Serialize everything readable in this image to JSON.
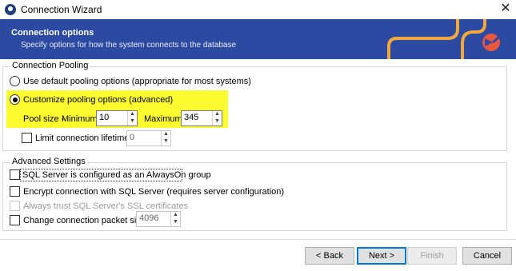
{
  "window": {
    "title": "Connection Wizard",
    "close_icon": "close-icon",
    "app_icon": "dbforge-icon"
  },
  "banner": {
    "title": "Connection options",
    "subtitle": "Specify options for how the system connects to the database",
    "logo_icon": "brand-logo-icon",
    "colors": {
      "background": "#2c4aa2",
      "accent": "#f2a93b",
      "logo": "#e9573f"
    }
  },
  "pooling": {
    "legend": "Connection Pooling",
    "default_option": "Use default pooling options (appropriate for most systems)",
    "custom_option": "Customize pooling options (advanced)",
    "pool_size_label": "Pool size - ",
    "minimum_label": "Minimum:",
    "minimum_value": "10",
    "maximum_label": "Maximum:",
    "maximum_value": "345",
    "lifetime_label": "Limit connection lifetime:",
    "lifetime_value": "0",
    "highlight_color": "#fbfb2f"
  },
  "advanced": {
    "legend": "Advanced Settings",
    "alwayson_label": "SQL Server is configured as an AlwaysOn group",
    "encrypt_label": "Encrypt connection with SQL Server (requires server configuration)",
    "trust_label": "Always trust SQL Server's SSL certificates",
    "packet_label": "Change connection packet size:",
    "packet_value": "4096"
  },
  "buttons": {
    "back": "< Back",
    "next": "Next >",
    "finish": "Finish",
    "cancel": "Cancel"
  }
}
